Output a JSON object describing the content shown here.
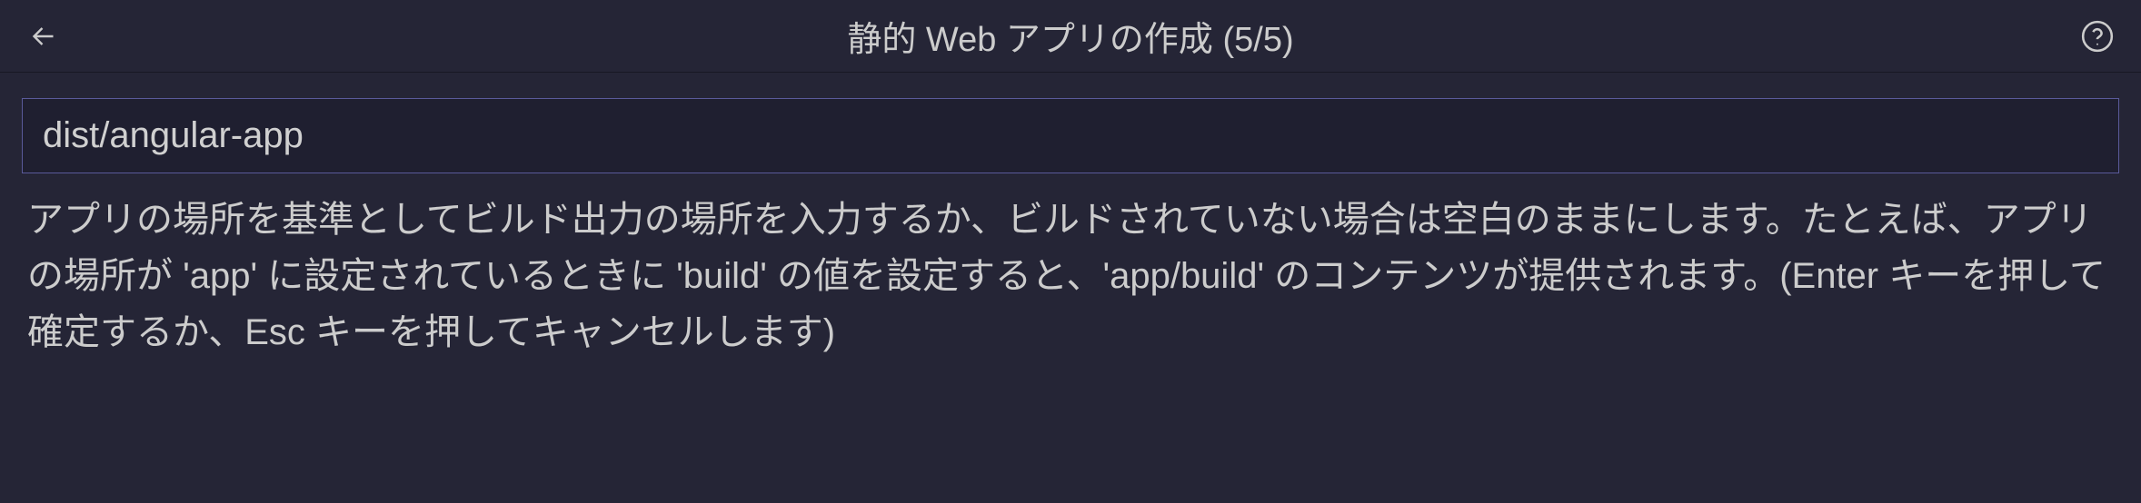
{
  "header": {
    "title": "静的 Web アプリの作成 (5/5)"
  },
  "input": {
    "value": "dist/angular-app",
    "placeholder": ""
  },
  "description": "アプリの場所を基準としてビルド出力の場所を入力するか、ビルドされていない場合は空白のままにします。たとえば、アプリの場所が 'app' に設定されているときに 'build' の値を設定すると、'app/build' のコンテンツが提供されます。(Enter キーを押して確定するか、Esc キーを押してキャンセルします)"
}
